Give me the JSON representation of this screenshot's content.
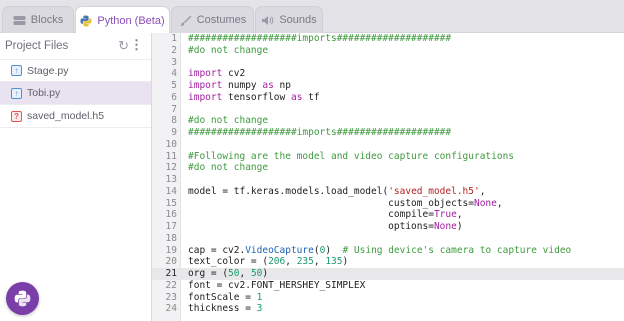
{
  "tabs": [
    {
      "label": "Blocks",
      "icon": "blocks-icon"
    },
    {
      "label": "Python (Beta)",
      "icon": "python-icon"
    },
    {
      "label": "Costumes",
      "icon": "brush-icon"
    },
    {
      "label": "Sounds",
      "icon": "speaker-icon"
    }
  ],
  "sidebar": {
    "title": "Project Files",
    "files": [
      {
        "name": "Stage.py",
        "type": "py"
      },
      {
        "name": "Tobi.py",
        "type": "py"
      },
      {
        "name": "saved_model.h5",
        "type": "h5"
      }
    ]
  },
  "editor": {
    "current_line": 21,
    "lines": [
      {
        "n": "1",
        "parts": [
          {
            "t": "###################imports####################",
            "c": "c"
          }
        ]
      },
      {
        "n": "2",
        "parts": [
          {
            "t": "#do not change",
            "c": "c"
          }
        ]
      },
      {
        "n": "3",
        "parts": []
      },
      {
        "n": "4",
        "parts": [
          {
            "t": "import",
            "c": "k"
          },
          {
            "t": " cv2",
            "c": ""
          }
        ]
      },
      {
        "n": "5",
        "parts": [
          {
            "t": "import",
            "c": "k"
          },
          {
            "t": " numpy ",
            "c": ""
          },
          {
            "t": "as",
            "c": "k"
          },
          {
            "t": " np",
            "c": ""
          }
        ]
      },
      {
        "n": "6",
        "parts": [
          {
            "t": "import",
            "c": "k"
          },
          {
            "t": " tensorflow ",
            "c": ""
          },
          {
            "t": "as",
            "c": "k"
          },
          {
            "t": " tf",
            "c": ""
          }
        ]
      },
      {
        "n": "7",
        "parts": []
      },
      {
        "n": "8",
        "parts": [
          {
            "t": "#do not change",
            "c": "c"
          }
        ]
      },
      {
        "n": "9",
        "parts": [
          {
            "t": "###################imports####################",
            "c": "c"
          }
        ]
      },
      {
        "n": "10",
        "parts": []
      },
      {
        "n": "11",
        "parts": [
          {
            "t": "#Following are the model and video capture configurations",
            "c": "c"
          }
        ]
      },
      {
        "n": "12",
        "parts": [
          {
            "t": "#do not change",
            "c": "c"
          }
        ]
      },
      {
        "n": "13",
        "parts": []
      },
      {
        "n": "14",
        "parts": [
          {
            "t": "model = tf.keras.models.load_model(",
            "c": ""
          },
          {
            "t": "'saved_model.h5'",
            "c": "s"
          },
          {
            "t": ",",
            "c": ""
          }
        ]
      },
      {
        "n": "15",
        "parts": [
          {
            "t": "                                   custom_objects=",
            "c": ""
          },
          {
            "t": "None",
            "c": "k"
          },
          {
            "t": ",",
            "c": ""
          }
        ]
      },
      {
        "n": "16",
        "parts": [
          {
            "t": "                                   compile=",
            "c": ""
          },
          {
            "t": "True",
            "c": "k"
          },
          {
            "t": ",",
            "c": ""
          }
        ]
      },
      {
        "n": "17",
        "parts": [
          {
            "t": "                                   options=",
            "c": ""
          },
          {
            "t": "None",
            "c": "k"
          },
          {
            "t": ")",
            "c": ""
          }
        ]
      },
      {
        "n": "18",
        "parts": []
      },
      {
        "n": "19",
        "parts": [
          {
            "t": "cap = cv2.",
            "c": ""
          },
          {
            "t": "VideoCapture",
            "c": "f"
          },
          {
            "t": "(",
            "c": ""
          },
          {
            "t": "0",
            "c": "n"
          },
          {
            "t": ")  ",
            "c": ""
          },
          {
            "t": "# Using device's camera to capture video",
            "c": "c"
          }
        ]
      },
      {
        "n": "20",
        "parts": [
          {
            "t": "text_color = (",
            "c": ""
          },
          {
            "t": "206",
            "c": "n"
          },
          {
            "t": ", ",
            "c": ""
          },
          {
            "t": "235",
            "c": "n"
          },
          {
            "t": ", ",
            "c": ""
          },
          {
            "t": "135",
            "c": "n"
          },
          {
            "t": ")",
            "c": ""
          }
        ]
      },
      {
        "n": "21",
        "parts": [
          {
            "t": "org = (",
            "c": ""
          },
          {
            "t": "50",
            "c": "n"
          },
          {
            "t": ", ",
            "c": ""
          },
          {
            "t": "50",
            "c": "n"
          },
          {
            "t": ")",
            "c": ""
          }
        ]
      },
      {
        "n": "22",
        "parts": [
          {
            "t": "font = cv2.FONT_HERSHEY_SIMPLEX",
            "c": ""
          }
        ]
      },
      {
        "n": "23",
        "parts": [
          {
            "t": "fontScale = ",
            "c": ""
          },
          {
            "t": "1",
            "c": "n"
          }
        ]
      },
      {
        "n": "24",
        "parts": [
          {
            "t": "thickness = ",
            "c": ""
          },
          {
            "t": "3",
            "c": "n"
          }
        ]
      }
    ]
  },
  "colors": {
    "accent": "#8a4fb8",
    "fab": "#7a3ea8",
    "comment": "#3f9a3f",
    "keyword": "#a31fa3",
    "string": "#b22222",
    "number": "#1c9a6b"
  }
}
